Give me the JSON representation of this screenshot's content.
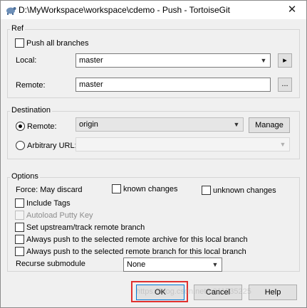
{
  "window": {
    "title": "D:\\MyWorkspace\\workspace\\cdemo - Push - TortoiseGit",
    "close_glyph": "✕"
  },
  "ref": {
    "legend": "Ref",
    "push_all_branches": "Push all branches",
    "local_label": "Local:",
    "local_value": "master",
    "local_btn": "▸",
    "remote_label": "Remote:",
    "remote_value": "master",
    "remote_btn": "..."
  },
  "destination": {
    "legend": "Destination",
    "remote_label": "Remote:",
    "remote_value": "origin",
    "manage_btn": "Manage",
    "arbitrary_label": "Arbitrary URL:",
    "arbitrary_value": ""
  },
  "options": {
    "legend": "Options",
    "force_label": "Force: May discard",
    "known_changes": "known changes",
    "unknown_changes": "unknown changes",
    "include_tags": "Include Tags",
    "autoload_putty": "Autoload Putty Key",
    "set_upstream": "Set upstream/track remote branch",
    "always_push_archive": "Always push to the selected remote archive for this local branch",
    "always_push_branch": "Always push to the selected remote branch for this local branch",
    "recurse_label": "Recurse submodule",
    "recurse_value": "None"
  },
  "buttons": {
    "ok": "OK",
    "cancel": "Cancel",
    "help": "Help"
  },
  "watermark": "https://blog.csdn.net/u011535225",
  "colors": {
    "highlight": "#e0312f"
  }
}
